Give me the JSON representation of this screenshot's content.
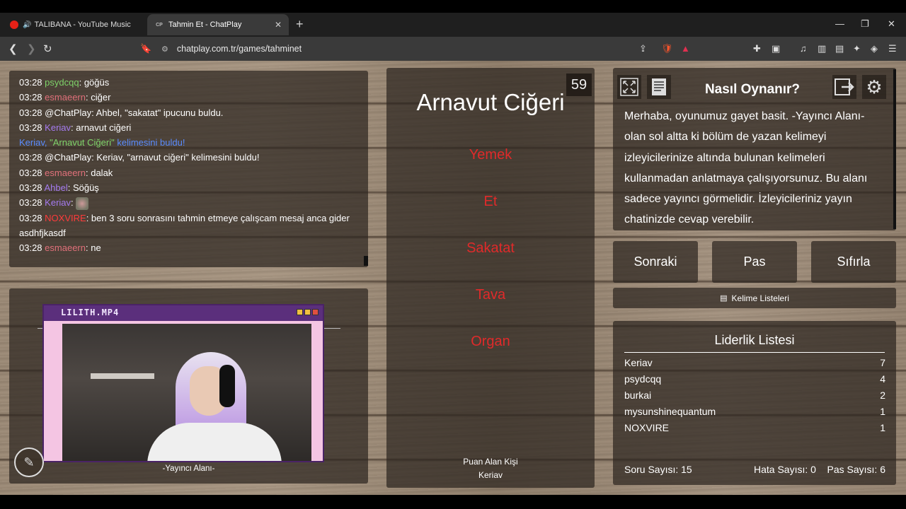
{
  "browser": {
    "tabs": [
      {
        "title": "TALIBANA - YouTube Music",
        "active": false
      },
      {
        "title": "Tahmin Et - ChatPlay",
        "active": true
      }
    ],
    "url": "chatplay.com.tr/games/tahminet"
  },
  "chat": {
    "messages": [
      {
        "time": "03:28",
        "user": "psydcqq",
        "sep": ": ",
        "text": "göğüs"
      },
      {
        "time": "03:28",
        "user": "esmaeern",
        "sep": ": ",
        "text": "ciğer"
      },
      {
        "time": "03:28",
        "user": "",
        "sep": "",
        "text": "@ChatPlay: Ahbel, \"sakatat\" ipucunu buldu."
      },
      {
        "time": "03:28",
        "user": "Keriav",
        "sep": ": ",
        "text": "arnavut ciğeri"
      },
      {
        "time": "",
        "user": "Keriav",
        "sep": ", ",
        "text": "kelimesini buldu!",
        "word": "\"Arnavut Ciğeri\" "
      },
      {
        "time": "03:28",
        "user": "",
        "sep": "",
        "text": "@ChatPlay: Keriav, \"arnavut ciğeri\" kelimesini buldu!"
      },
      {
        "time": "03:28",
        "user": "esmaeern",
        "sep": ": ",
        "text": "dalak"
      },
      {
        "time": "03:28",
        "user": "Ahbel",
        "sep": ": ",
        "text": "Söğüş"
      },
      {
        "time": "03:28",
        "user": "Keriav",
        "sep": ": ",
        "text": ""
      },
      {
        "time": "03:28",
        "user": "NOXVIRE",
        "sep": ": ",
        "text": "ben 3 soru sonrasını tahmin etmeye çalışcam mesaj anca gider asdhfjkasdf"
      },
      {
        "time": "03:28",
        "user": "esmaeern",
        "sep": ": ",
        "text": "ne"
      }
    ]
  },
  "streamer": {
    "window_title": "LILITH.MP4",
    "caption": "-Yayıncı Alanı-"
  },
  "game": {
    "timer": "59",
    "word": "Arnavut Ciğeri",
    "taboo_words": [
      "Yemek",
      "Et",
      "Sakatat",
      "Tava",
      "Organ"
    ],
    "scorer_label": "Puan Alan Kişi",
    "scorer": "Keriav"
  },
  "info": {
    "title": "Nasıl Oynanır?",
    "text": "Merhaba, oyunumuz gayet basit. -Yayıncı Alanı- olan sol altta ki bölüm de yazan kelimeyi izleyicilerinize altında bulunan kelimeleri kullanmadan anlatmaya çalışıyorsunuz. Bu alanı sadece yayıncı görmelidir. İzleyicileriniz yayın chatinizde cevap verebilir."
  },
  "buttons": {
    "next": "Sonraki",
    "pass": "Pas",
    "reset": "Sıfırla",
    "word_lists": "Kelime Listeleri"
  },
  "leaderboard": {
    "title": "Liderlik Listesi",
    "rows": [
      {
        "name": "Keriav",
        "score": "7"
      },
      {
        "name": "psydcqq",
        "score": "4"
      },
      {
        "name": "burkai",
        "score": "2"
      },
      {
        "name": "mysunshinequantum",
        "score": "1"
      },
      {
        "name": "NOXVIRE",
        "score": "1"
      }
    ],
    "question_count": "Soru Sayısı: 15",
    "error_count": "Hata Sayısı: 0",
    "pass_count": "Pas Sayısı: 6"
  }
}
